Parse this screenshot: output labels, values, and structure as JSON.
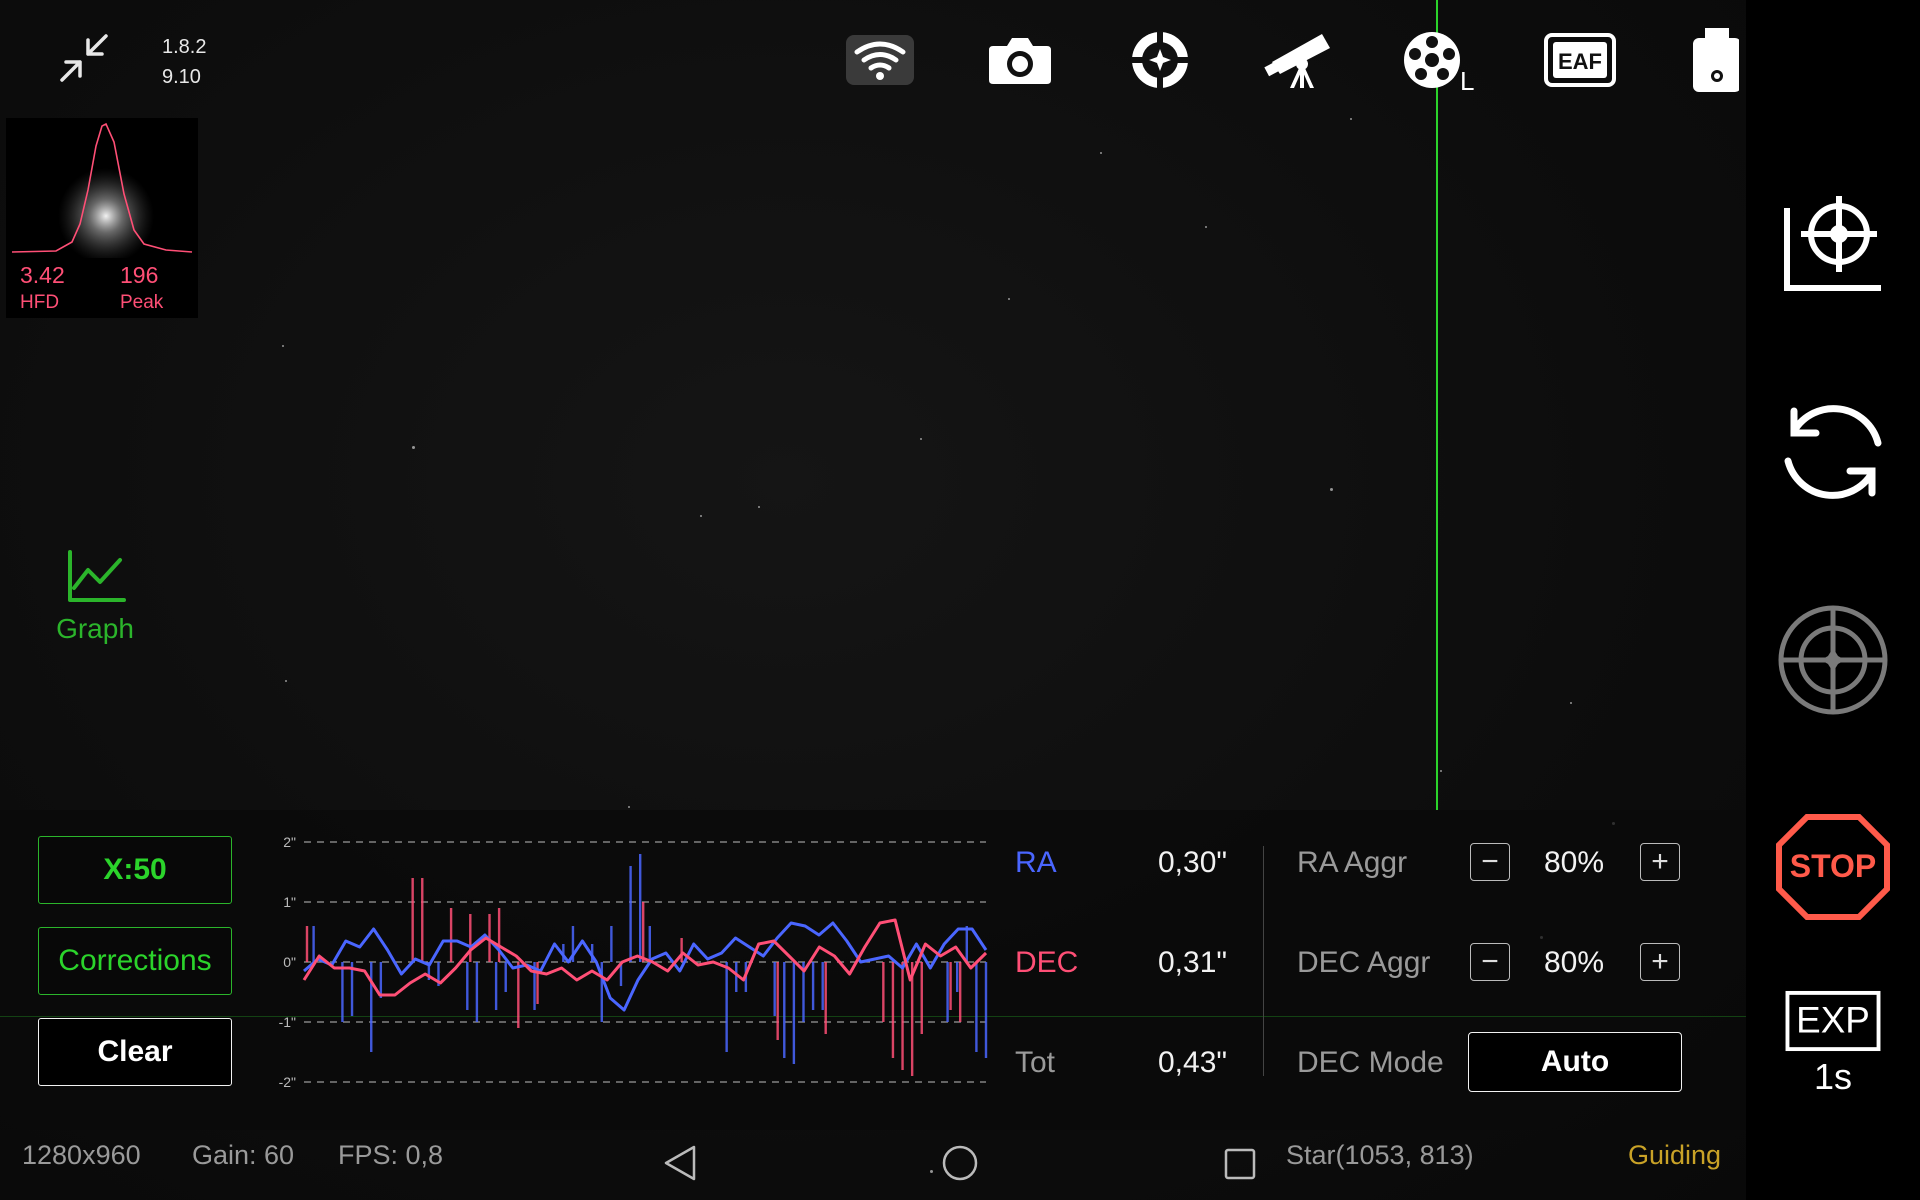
{
  "app": {
    "version_line1": "1.8.2",
    "version_line2": "9.10"
  },
  "toolbar": {
    "icons": [
      "shrink-icon",
      "wifi-icon",
      "camera-icon",
      "guide-camera-icon",
      "telescope-icon",
      "filter-wheel-icon",
      "eaf-icon",
      "usb-storage-icon",
      "info-icon"
    ],
    "filter_label": "L",
    "eaf_label": "EAF"
  },
  "star_profile": {
    "hfd_value": "3.42",
    "hfd_label": "HFD",
    "peak_value": "196",
    "peak_label": "Peak"
  },
  "graph_toggle": {
    "label": "Graph"
  },
  "panel": {
    "x_scale_label": "X:50",
    "corrections_label": "Corrections",
    "clear_label": "Clear",
    "stats": {
      "ra_label": "RA",
      "ra_value": "0,30\"",
      "dec_label": "DEC",
      "dec_value": "0,31\"",
      "tot_label": "Tot",
      "tot_value": "0,43\""
    },
    "aggressiveness": {
      "ra_label": "RA Aggr",
      "ra_value": "80%",
      "dec_label": "DEC Aggr",
      "dec_value": "80%",
      "minus": "−",
      "plus": "+"
    },
    "dec_mode": {
      "label": "DEC Mode",
      "value": "Auto"
    }
  },
  "sidebar": {
    "icons": [
      "calibrate-icon",
      "loop-icon",
      "guide-target-icon",
      "stop-icon",
      "exposure-icon"
    ],
    "stop_label": "STOP",
    "exp_label": "EXP",
    "exp_value": "1s"
  },
  "status_bar": {
    "resolution": "1280x960",
    "gain": "Gain: 60",
    "fps": "FPS: 0,8",
    "star": "Star(1053, 813)",
    "state": "Guiding"
  },
  "colors": {
    "ra": "#4a66ff",
    "dec": "#ff4f76",
    "accent_green": "#2bd42b",
    "guiding": "#c9a227",
    "stop": "#ff5a4a"
  },
  "chart_data": {
    "type": "line",
    "title": "",
    "xlabel": "",
    "ylabel": "",
    "ylim": [
      -2,
      2
    ],
    "y_ticks": [
      "2\"",
      "1\"",
      "0\"",
      "-1\"",
      "-2\""
    ],
    "series": [
      {
        "name": "RA",
        "color": "#4a66ff",
        "values": [
          -0.15,
          0.05,
          -0.05,
          0.35,
          0.25,
          0.55,
          0.2,
          -0.2,
          0.05,
          -0.05,
          0.35,
          0.35,
          0.25,
          0.45,
          0.2,
          -0.1,
          -0.05,
          -0.15,
          0.3,
          0.0,
          0.35,
          0.0,
          -0.6,
          -0.8,
          -0.3,
          0.05,
          0.15,
          -0.15,
          0.3,
          0.05,
          0.15,
          0.4,
          0.25,
          0.1,
          0.4,
          0.65,
          0.6,
          0.45,
          0.65,
          0.35,
          0.0,
          0.05,
          0.1,
          -0.1,
          0.3,
          -0.1,
          0.3,
          0.55,
          0.55,
          0.2
        ]
      },
      {
        "name": "DEC",
        "color": "#ff4f76",
        "values": [
          -0.3,
          0.1,
          -0.1,
          -0.1,
          -0.15,
          -0.55,
          -0.55,
          -0.35,
          -0.2,
          -0.35,
          -0.1,
          0.2,
          0.4,
          0.25,
          0.1,
          -0.15,
          -0.2,
          -0.1,
          -0.3,
          -0.15,
          -0.3,
          0.0,
          0.1,
          0.0,
          -0.15,
          0.15,
          -0.05,
          0.0,
          -0.1,
          -0.3,
          0.3,
          0.35,
          0.1,
          -0.15,
          0.25,
          0.1,
          -0.2,
          0.25,
          0.65,
          0.7,
          -0.3,
          0.3,
          0.1,
          0.25,
          -0.1,
          0.15
        ]
      },
      {
        "name": "RA corrections",
        "color": "#4a66ff",
        "values": [
          0.0,
          0.6,
          0.0,
          0.0,
          -1.0,
          -0.9,
          0.0,
          -1.5,
          -0.6,
          0.0,
          0.0,
          0.0,
          0.0,
          -0.3,
          -0.4,
          0.0,
          0.0,
          -0.8,
          -1.0,
          0.0,
          -0.8,
          -0.5,
          0.0,
          0.0,
          -0.8,
          0.0,
          0.0,
          0.3,
          0.6,
          0.0,
          0.3,
          -1.0,
          0.6,
          -0.4,
          1.6,
          1.8,
          0.6,
          0.0,
          0.0,
          0.0,
          0.0,
          0.0,
          0.0,
          0.0,
          -1.5,
          -0.5,
          -0.5,
          0.0,
          0.0,
          -0.9,
          -1.6,
          -1.7,
          -1.0,
          -0.8,
          -0.8,
          0.0,
          0.0,
          0.0,
          0.0,
          0.0,
          0.0,
          0.0,
          0.0,
          0.0,
          0.0,
          0.0,
          0.0,
          -1.0,
          -0.5,
          0.6,
          -1.5,
          -1.6
        ]
      },
      {
        "name": "DEC corrections",
        "color": "#ff4f76",
        "values": [
          0.6,
          0.0,
          0.0,
          0.0,
          0.0,
          0.0,
          0.0,
          0.0,
          0.0,
          0.0,
          0.0,
          1.4,
          1.4,
          0.0,
          0.0,
          0.9,
          0.0,
          0.8,
          0.0,
          0.8,
          0.9,
          0.0,
          -1.1,
          0.0,
          -0.7,
          0.0,
          0.0,
          0.0,
          0.0,
          0.0,
          0.0,
          0.0,
          0.0,
          0.0,
          0.0,
          1.0,
          0.0,
          0.0,
          0.0,
          0.4,
          0.0,
          0.0,
          0.0,
          0.0,
          0.0,
          0.0,
          0.0,
          0.0,
          0.0,
          -1.3,
          0.0,
          0.0,
          0.0,
          0.0,
          -1.2,
          0.0,
          0.0,
          0.0,
          0.0,
          0.0,
          -1.0,
          -1.6,
          -1.8,
          -1.9,
          -1.2,
          0.0,
          0.0,
          -0.8,
          -1.0,
          0.0,
          0.0,
          0.0
        ]
      }
    ]
  }
}
